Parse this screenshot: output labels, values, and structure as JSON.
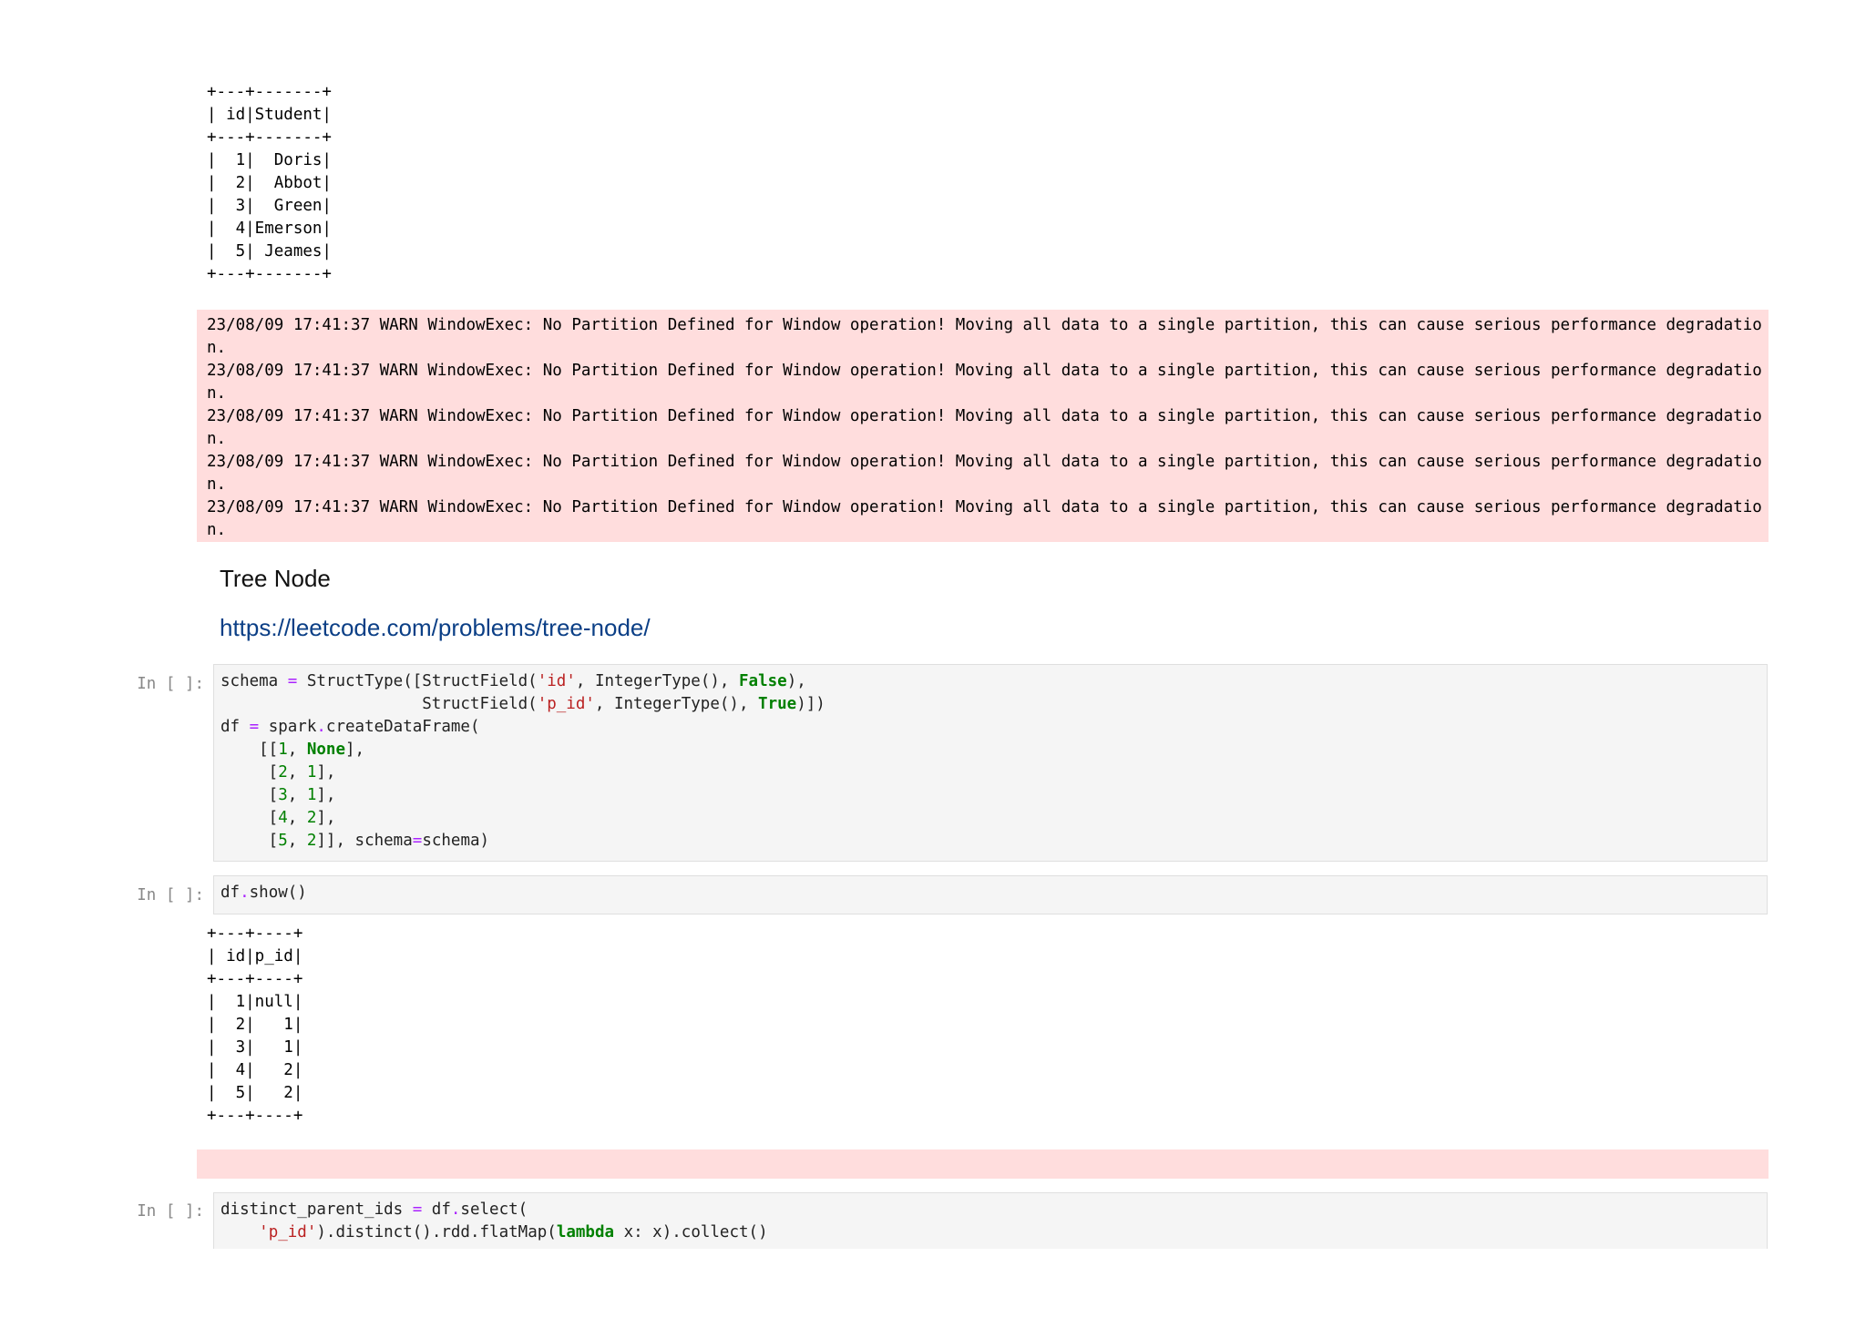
{
  "students_table": {
    "lines": [
      "+---+-------+",
      "| id|Student|",
      "+---+-------+",
      "|  1|  Doris|",
      "|  2|  Abbot|",
      "|  3|  Green|",
      "|  4|Emerson|",
      "|  5| Jeames|",
      "+---+-------+"
    ]
  },
  "warnings": {
    "lines": [
      "23/08/09 17:41:37 WARN WindowExec: No Partition Defined for Window operation! Moving all data to a single partition, this can cause serious performance degradatio",
      "n.",
      "23/08/09 17:41:37 WARN WindowExec: No Partition Defined for Window operation! Moving all data to a single partition, this can cause serious performance degradatio",
      "n.",
      "23/08/09 17:41:37 WARN WindowExec: No Partition Defined for Window operation! Moving all data to a single partition, this can cause serious performance degradatio",
      "n.",
      "23/08/09 17:41:37 WARN WindowExec: No Partition Defined for Window operation! Moving all data to a single partition, this can cause serious performance degradatio",
      "n.",
      "23/08/09 17:41:37 WARN WindowExec: No Partition Defined for Window operation! Moving all data to a single partition, this can cause serious performance degradatio",
      "n."
    ]
  },
  "markdown": {
    "heading": "Tree Node",
    "link": "https://leetcode.com/problems/tree-node/"
  },
  "cells": {
    "prompt": "In [ ]:",
    "schema_cell": {
      "l1a": "schema ",
      "l1b": "=",
      "l1c": " StructType([StructField(",
      "l1d": "'id'",
      "l1e": ", IntegerType(), ",
      "l1f": "False",
      "l1g": "),",
      "l2a": "                     StructField(",
      "l2b": "'p_id'",
      "l2c": ", IntegerType(), ",
      "l2d": "True",
      "l2e": ")])",
      "l3a": "df ",
      "l3b": "=",
      "l3c": " spark",
      "l3d": ".",
      "l3e": "createDataFrame(",
      "l4a": "    [[",
      "l4b": "1",
      "l4c": ", ",
      "l4d": "None",
      "l4e": "],",
      "r2": [
        "2",
        "1"
      ],
      "r3": [
        "3",
        "1"
      ],
      "r4": [
        "4",
        "2"
      ],
      "r5": [
        "5",
        "2"
      ],
      "l8tail": ", schema",
      "l8eq": "=",
      "l8end": "schema)"
    },
    "show_cell": {
      "a": "df",
      "b": ".",
      "c": "show()"
    },
    "distinct_cell": {
      "l1a": "distinct_parent_ids ",
      "l1b": "=",
      "l1c": " df",
      "l1d": ".",
      "l1e": "select(",
      "l2a": "    ",
      "l2b": "'p_id'",
      "l2c": ")",
      "l2d": ".distinct()",
      "l2e": ".rdd",
      "l2f": ".flatMap(",
      "l2g": "lambda",
      "l2h": " x: x)",
      "l2i": ".collect()"
    }
  },
  "tree_table": {
    "lines": [
      "+---+----+",
      "| id|p_id|",
      "+---+----+",
      "|  1|null|",
      "|  2|   1|",
      "|  3|   1|",
      "|  4|   2|",
      "|  5|   2|",
      "+---+----+"
    ]
  }
}
